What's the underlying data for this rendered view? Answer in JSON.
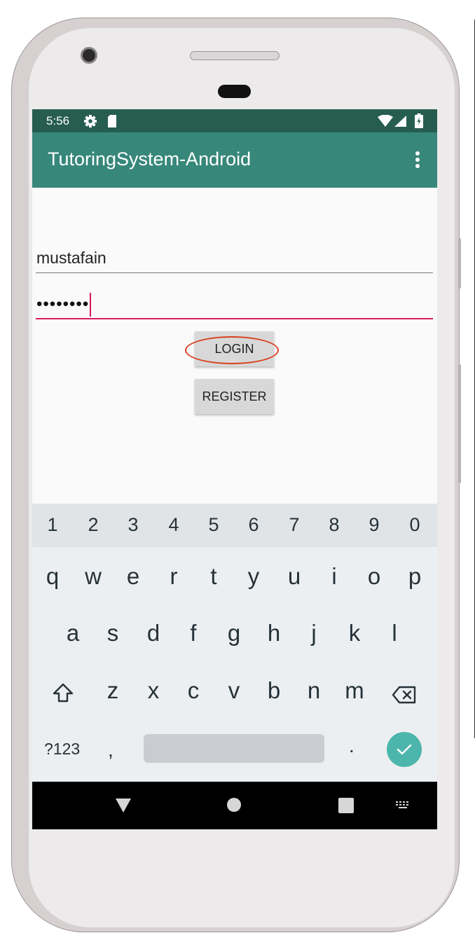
{
  "status_bar": {
    "time": "5:56",
    "icons": [
      "settings-icon",
      "sd-card-icon",
      "wifi-icon",
      "signal-icon",
      "battery-icon"
    ]
  },
  "app_bar": {
    "title": "TutoringSystem-Android",
    "overflow_icon": "more-vert-icon"
  },
  "form": {
    "username_value": "mustafain",
    "password_value": "••••••••",
    "login_label": "LOGIN",
    "register_label": "REGISTER"
  },
  "keyboard": {
    "numbers": [
      "1",
      "2",
      "3",
      "4",
      "5",
      "6",
      "7",
      "8",
      "9",
      "0"
    ],
    "row1": [
      "q",
      "w",
      "e",
      "r",
      "t",
      "y",
      "u",
      "i",
      "o",
      "p"
    ],
    "row2": [
      "a",
      "s",
      "d",
      "f",
      "g",
      "h",
      "j",
      "k",
      "l"
    ],
    "row3": [
      "z",
      "x",
      "c",
      "v",
      "b",
      "n",
      "m"
    ],
    "symbols_label": "?123",
    "comma": ",",
    "period": ".",
    "shift_icon": "shift-icon",
    "backspace_icon": "backspace-icon",
    "enter_icon": "check-icon"
  },
  "nav_bar": {
    "icons": [
      "back-icon",
      "home-icon",
      "recents-icon",
      "keyboard-switch-icon"
    ]
  },
  "colors": {
    "status_bar": "#265d4f",
    "app_bar": "#37877a",
    "accent": "#d81b60",
    "highlight": "#d9411f",
    "enter_key": "#4db6ac"
  }
}
